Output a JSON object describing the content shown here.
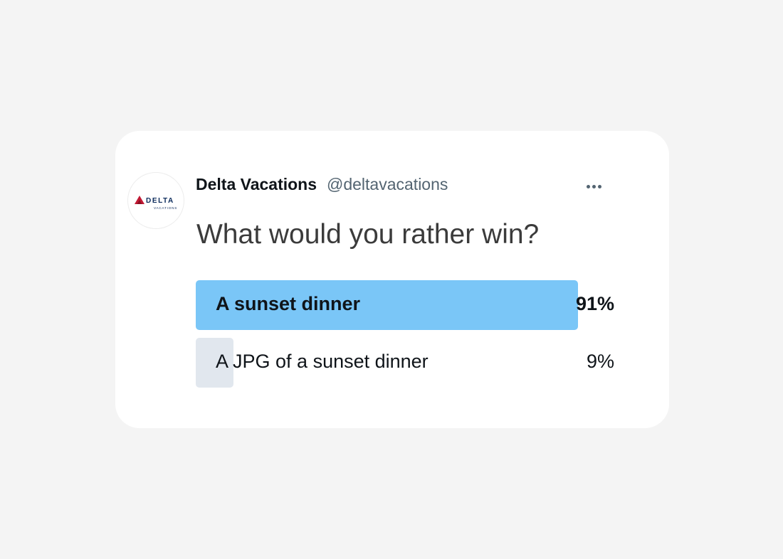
{
  "tweet": {
    "author_name": "Delta Vacations",
    "author_handle": "@deltavacations",
    "avatar_logo": {
      "brand": "DELTA",
      "sub": "VACATIONS",
      "icon": "delta-widget-logo"
    },
    "more_icon": "more-horizontal-icon",
    "question": "What would you rather win?"
  },
  "poll": {
    "options": [
      {
        "label": "A sunset dinner",
        "percent": "91%",
        "value": 0.91,
        "winner": true
      },
      {
        "label": "A JPG of a sunset dinner",
        "percent": "9%",
        "value": 0.09,
        "winner": false
      }
    ]
  },
  "colors": {
    "winner_bar": "#7ac6f7",
    "other_bar": "#e1e7ee",
    "delta_red": "#c01933",
    "delta_navy": "#0b2a5b"
  }
}
